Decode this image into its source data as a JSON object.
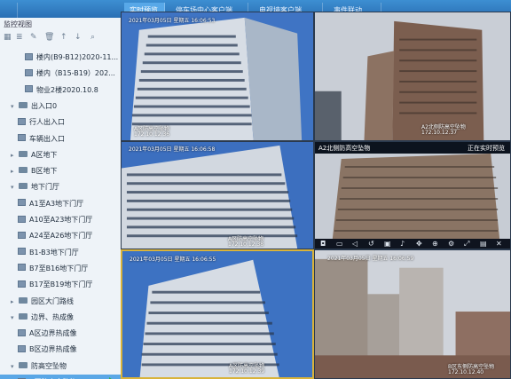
{
  "tabs": [
    {
      "label": "实时预览",
      "active": true
    },
    {
      "label": "停车场中心客户端",
      "active": false
    },
    {
      "label": "电视墙客户端",
      "active": false
    },
    {
      "label": "事件联动",
      "active": false
    }
  ],
  "sidebar": {
    "title": "监控视图",
    "tools": [
      "新建",
      "编辑",
      "删除",
      "上移",
      "下移",
      "搜索"
    ],
    "items": [
      {
        "label": "楼内(B9-B12)2020-11...",
        "type": "cam",
        "level": 3
      },
      {
        "label": "楼内（B15-B19）202...",
        "type": "cam",
        "level": 3
      },
      {
        "label": "物业2楼2020.10.8",
        "type": "cam",
        "level": 3
      },
      {
        "label": "出入口0",
        "type": "folder",
        "level": 1,
        "expanded": true
      },
      {
        "label": "行人出入口",
        "type": "cam",
        "level": 2
      },
      {
        "label": "车辆出入口",
        "type": "cam",
        "level": 2
      },
      {
        "label": "A区地下",
        "type": "folder",
        "level": 1,
        "expanded": false
      },
      {
        "label": "B区地下",
        "type": "folder",
        "level": 1,
        "expanded": false
      },
      {
        "label": "地下门厅",
        "type": "folder",
        "level": 1,
        "expanded": true
      },
      {
        "label": "A1至A3地下门厅",
        "type": "cam",
        "level": 2
      },
      {
        "label": "A10至A23地下门厅",
        "type": "cam",
        "level": 2
      },
      {
        "label": "A24至A26地下门厅",
        "type": "cam",
        "level": 2
      },
      {
        "label": "B1-B3地下门厅",
        "type": "cam",
        "level": 2
      },
      {
        "label": "B7至B16地下门厅",
        "type": "cam",
        "level": 2
      },
      {
        "label": "B17至B19地下门厅",
        "type": "cam",
        "level": 2
      },
      {
        "label": "园区大门路线",
        "type": "folder",
        "level": 1,
        "expanded": false
      },
      {
        "label": "边界、热成像",
        "type": "folder",
        "level": 1,
        "expanded": true
      },
      {
        "label": "A区边界热成像",
        "type": "cam",
        "level": 2
      },
      {
        "label": "B区边界热成像",
        "type": "cam",
        "level": 2
      },
      {
        "label": "防高空坠物",
        "type": "folder",
        "level": 1,
        "expanded": true
      },
      {
        "label": "A区防高空坠物",
        "type": "cam",
        "level": 2,
        "selected": true
      }
    ]
  },
  "cells": [
    {
      "time": "2021年03月05日 星期五 16:06:53",
      "label": "A区防高空坠物",
      "ip": "172.10.12.36"
    },
    {
      "time": "",
      "label": "A2北侧防高空坠物",
      "ip": "172.10.12.37"
    },
    {
      "time": "2021年03月05日 星期五 16:06:58",
      "label": "A区防高空坠物",
      "ip": "172.10.12.38"
    },
    {
      "time": "",
      "label": "A2北侧防高空坠物",
      "ip": "",
      "status": "正在实时预览"
    },
    {
      "time": "2021年03月05日 星期五 16:06:55",
      "label": "A区防高空坠物",
      "ip": "172.10.12.39"
    },
    {
      "time": "2021年03月05日 星期五 16:06:59",
      "label": "B区东侧防高空坠物",
      "ip": "172.10.12.40"
    }
  ],
  "colors": {
    "accent": "#58a8e8",
    "selected_border": "#d9b33a",
    "play": "#2fb54b"
  }
}
